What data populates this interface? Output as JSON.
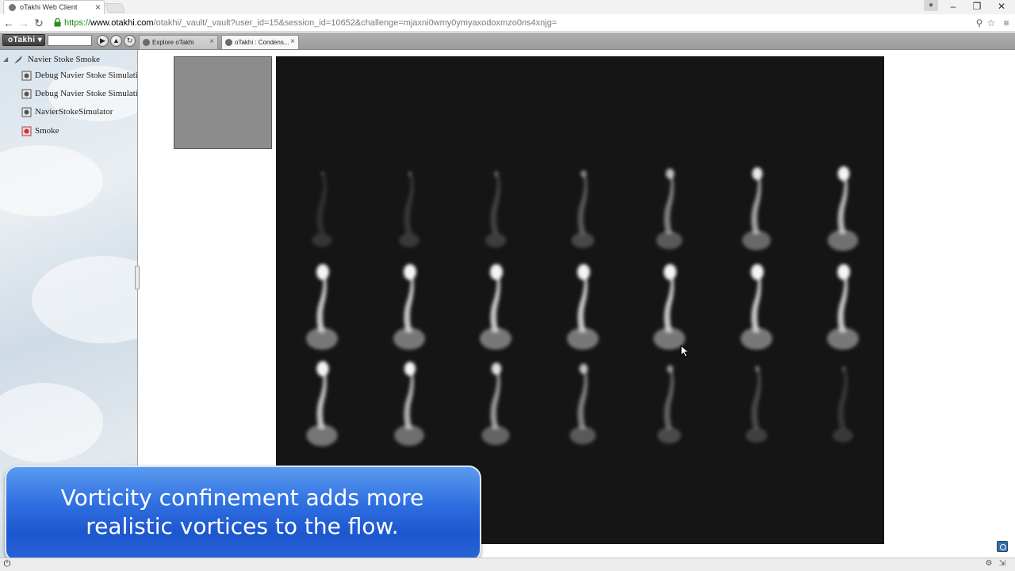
{
  "browser": {
    "tab_title": "oTakhi Web Client",
    "url_scheme": "https://",
    "url_host": "www.otakhi.com",
    "url_rest": "/otakhi/_vault/_vault?user_id=15&session_id=10652&challenge=mjaxni0wmy0ymyaxodoxmzo0ns4xnjg="
  },
  "app": {
    "menu_label": "oTakhi ▾",
    "tabs": [
      {
        "label": "Explore oTakhi"
      },
      {
        "label": "oTakhi : Condens..."
      }
    ]
  },
  "tree": {
    "root": {
      "label": "Navier Stoke Smoke",
      "icon": "feather-icon"
    },
    "children": [
      {
        "label": "Debug Navier Stoke Simulation",
        "icon": "script-icon"
      },
      {
        "label": "Debug Navier Stoke Simulation",
        "icon": "script-icon"
      },
      {
        "label": "NavierStokeSimulator",
        "icon": "script-icon"
      },
      {
        "label": "Smoke",
        "icon": "image-icon"
      }
    ]
  },
  "simulation": {
    "rows": 3,
    "columns": 7,
    "plume_intensity": [
      [
        0.05,
        0.1,
        0.15,
        0.3,
        0.55,
        0.75,
        0.9
      ],
      [
        1,
        1,
        1,
        1,
        1,
        1,
        1
      ],
      [
        0.95,
        0.85,
        0.7,
        0.55,
        0.35,
        0.2,
        0.1
      ]
    ]
  },
  "caption": {
    "line1": "Vorticity confinement adds more",
    "line2": "realistic vortices to the flow."
  }
}
